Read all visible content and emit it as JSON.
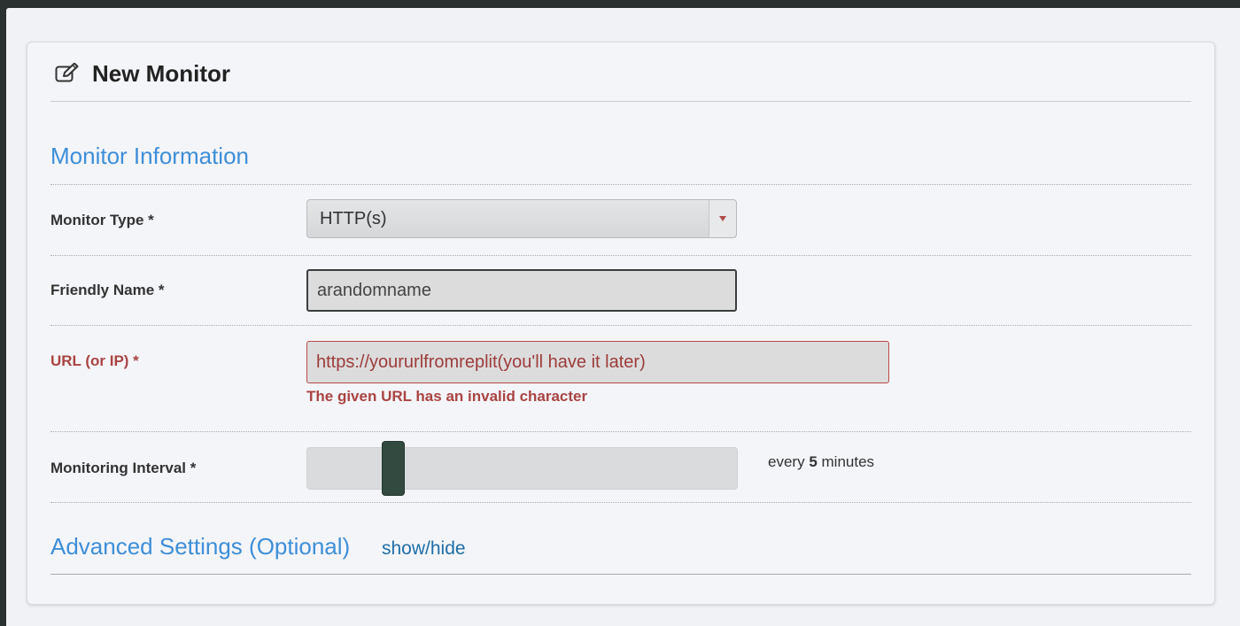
{
  "header": {
    "icon": "edit-icon",
    "title": "New Monitor"
  },
  "monitor_info": {
    "section_title": "Monitor Information",
    "monitor_type": {
      "label": "Monitor Type *",
      "selected": "HTTP(s)"
    },
    "friendly_name": {
      "label": "Friendly Name *",
      "value": "arandomname"
    },
    "url": {
      "label": "URL (or IP) *",
      "value": "https://yoururlfromreplit(you'll have it later)",
      "error": "The given URL has an invalid character"
    },
    "interval": {
      "label": "Monitoring Interval *",
      "prefix": "every",
      "value": "5",
      "suffix": "minutes"
    }
  },
  "advanced": {
    "section_title": "Advanced Settings (Optional)",
    "toggle_label": "show/hide"
  },
  "colors": {
    "section_title": "#3d8ed8",
    "error": "#a94442",
    "slider_handle": "#324a40",
    "link": "#1e6ea8"
  }
}
